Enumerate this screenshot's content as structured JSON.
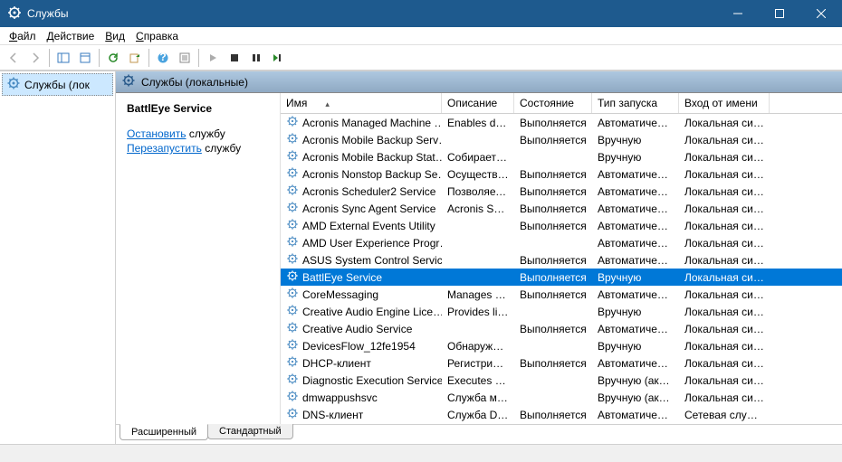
{
  "window": {
    "title": "Службы"
  },
  "menu": {
    "file": "Файл",
    "action": "Действие",
    "view": "Вид",
    "help": "Справка"
  },
  "tree": {
    "root": "Службы (лок"
  },
  "header": {
    "title": "Службы (локальные)"
  },
  "details": {
    "selected_name": "BattlEye Service",
    "stop_link": "Остановить",
    "stop_rest": " службу",
    "restart_link": "Перезапустить",
    "restart_rest": " службу"
  },
  "columns": {
    "name": "Имя",
    "desc": "Описание",
    "state": "Состояние",
    "start": "Тип запуска",
    "logon": "Вход от имени"
  },
  "services": [
    {
      "name": "Acronis Managed Machine …",
      "desc": "Enables da…",
      "state": "Выполняется",
      "start": "Автоматиче…",
      "logon": "Локальная сис…"
    },
    {
      "name": "Acronis Mobile Backup Serv…",
      "desc": "",
      "state": "Выполняется",
      "start": "Вручную",
      "logon": "Локальная сис…"
    },
    {
      "name": "Acronis Mobile Backup Stat…",
      "desc": "Собирает …",
      "state": "",
      "start": "Вручную",
      "logon": "Локальная сис…"
    },
    {
      "name": "Acronis Nonstop Backup Se…",
      "desc": "Осуществ…",
      "state": "Выполняется",
      "start": "Автоматиче…",
      "logon": "Локальная сис…"
    },
    {
      "name": "Acronis Scheduler2 Service",
      "desc": "Позволяет…",
      "state": "Выполняется",
      "start": "Автоматиче…",
      "logon": "Локальная сис…"
    },
    {
      "name": "Acronis Sync Agent Service",
      "desc": "Acronis Sy…",
      "state": "Выполняется",
      "start": "Автоматиче…",
      "logon": "Локальная сис…"
    },
    {
      "name": "AMD External Events Utility",
      "desc": "",
      "state": "Выполняется",
      "start": "Автоматиче…",
      "logon": "Локальная сис…"
    },
    {
      "name": "AMD User Experience Progr…",
      "desc": "",
      "state": "",
      "start": "Автоматиче…",
      "logon": "Локальная сис…"
    },
    {
      "name": "ASUS System Control Service",
      "desc": "",
      "state": "Выполняется",
      "start": "Автоматиче…",
      "logon": "Локальная сис…"
    },
    {
      "name": "BattlEye Service",
      "desc": "",
      "state": "Выполняется",
      "start": "Вручную",
      "logon": "Локальная сис…",
      "selected": true
    },
    {
      "name": "CoreMessaging",
      "desc": "Manages c…",
      "state": "Выполняется",
      "start": "Автоматиче…",
      "logon": "Локальная сис…"
    },
    {
      "name": "Creative Audio Engine Lice…",
      "desc": "Provides li…",
      "state": "",
      "start": "Вручную",
      "logon": "Локальная сис…"
    },
    {
      "name": "Creative Audio Service",
      "desc": "",
      "state": "Выполняется",
      "start": "Автоматиче…",
      "logon": "Локальная сис…"
    },
    {
      "name": "DevicesFlow_12fe1954",
      "desc": "Обнаруже…",
      "state": "",
      "start": "Вручную",
      "logon": "Локальная сис…"
    },
    {
      "name": "DHCP-клиент",
      "desc": "Регистрир…",
      "state": "Выполняется",
      "start": "Автоматиче…",
      "logon": "Локальная сис…"
    },
    {
      "name": "Diagnostic Execution Service",
      "desc": "Executes di…",
      "state": "",
      "start": "Вручную (ак…",
      "logon": "Локальная сис…"
    },
    {
      "name": "dmwappushsvc",
      "desc": "Служба м…",
      "state": "",
      "start": "Вручную (ак…",
      "logon": "Локальная сис…"
    },
    {
      "name": "DNS-клиент",
      "desc": "Служба D…",
      "state": "Выполняется",
      "start": "Автоматиче…",
      "logon": "Сетевая служба"
    }
  ],
  "tabs": {
    "extended": "Расширенный",
    "standard": "Стандартный"
  }
}
